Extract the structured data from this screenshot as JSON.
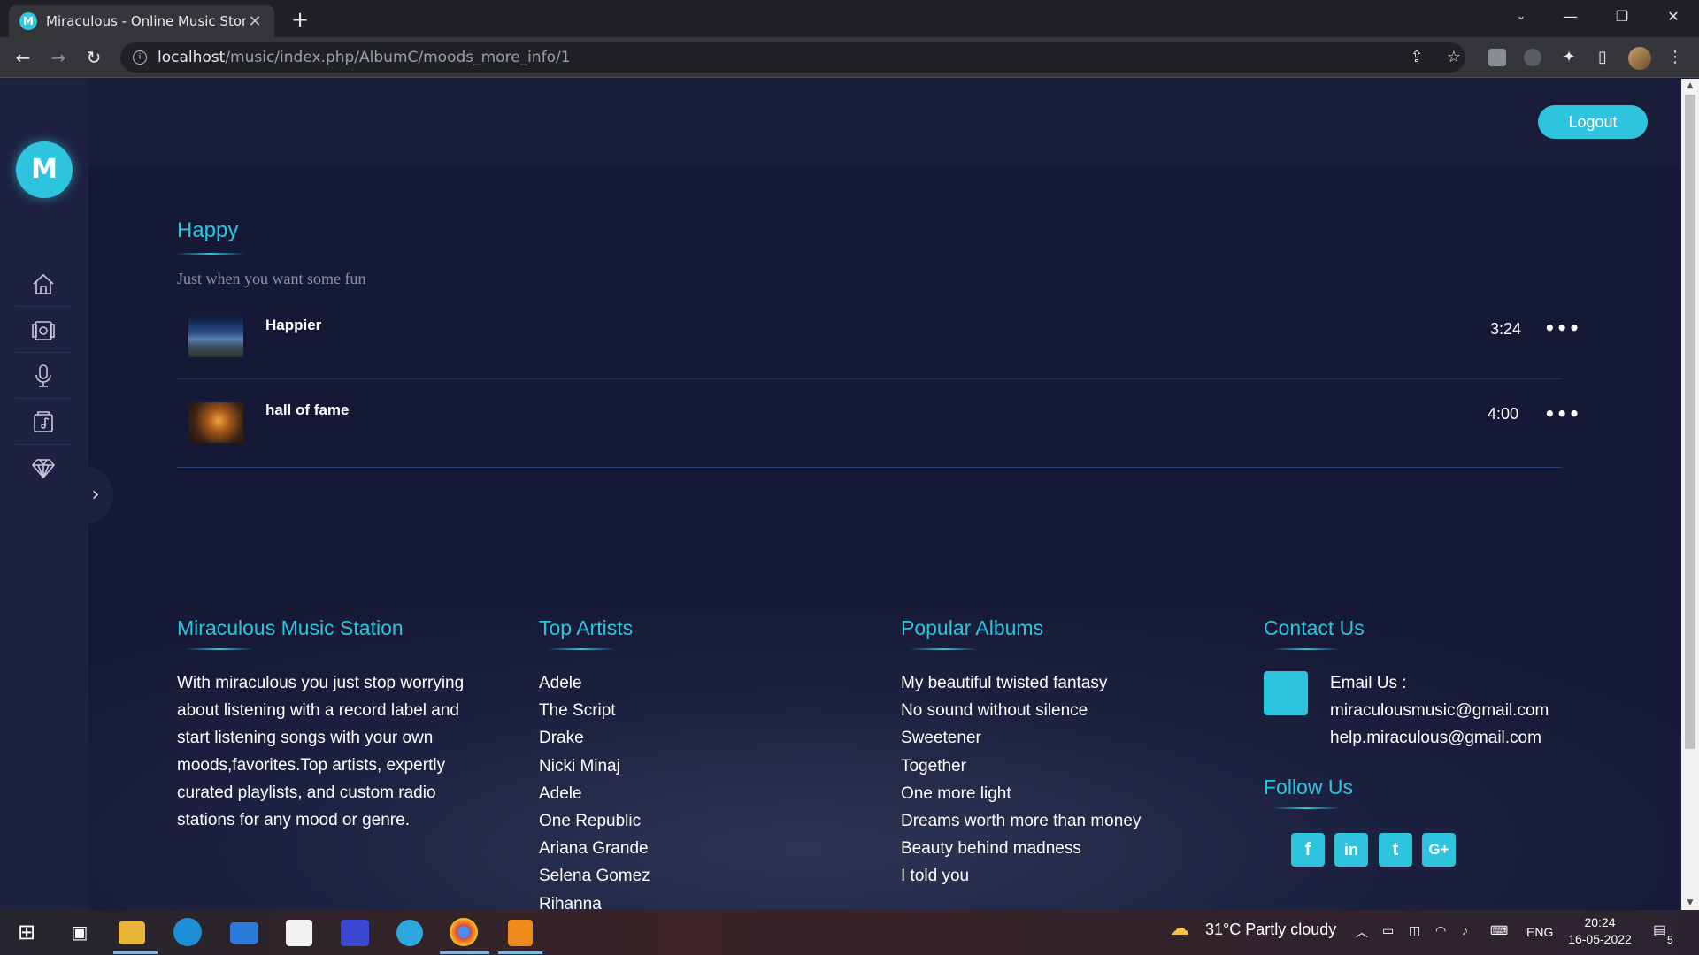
{
  "browser": {
    "tab_title": "Miraculous - Online Music Store",
    "favicon_letter": "M",
    "url_host": "localhost",
    "url_path": "/music/index.php/AlbumC/moods_more_info/1"
  },
  "app": {
    "logo_letter": "M",
    "logout_label": "Logout",
    "sidebar_icons": [
      "home-icon",
      "albums-icon",
      "microphone-icon",
      "music-file-icon",
      "diamond-icon"
    ]
  },
  "mood": {
    "title": "Happy",
    "subtitle": "Just when you want some fun",
    "songs": [
      {
        "name": "Happier",
        "duration": "3:24",
        "more": "•••"
      },
      {
        "name": "hall of fame",
        "duration": "4:00",
        "more": "•••"
      }
    ]
  },
  "footer": {
    "about_heading": "Miraculous Music Station",
    "about_text": "With miraculous you just stop worrying about listening with a record label and start listening songs with your own moods,favorites.Top artists, expertly curated playlists, and custom radio stations for any mood or genre.",
    "artists_heading": "Top Artists",
    "artists": [
      "Adele",
      "The Script",
      "Drake",
      "Nicki Minaj",
      "Adele",
      "One Republic",
      "Ariana Grande",
      "Selena Gomez",
      "Rihanna"
    ],
    "albums_heading": "Popular Albums",
    "albums": [
      "My beautiful twisted fantasy",
      "No sound without silence",
      "Sweetener",
      "Together",
      "One more light",
      "Dreams worth more than money",
      "Beauty behind madness",
      "I told you"
    ],
    "contact_heading": "Contact Us",
    "email_label": "Email Us :",
    "emails": [
      "miraculousmusic@gmail.com",
      "help.miraculous@gmail.com"
    ],
    "follow_heading": "Follow Us",
    "social": [
      "f",
      "in",
      "t",
      "G+"
    ]
  },
  "taskbar": {
    "weather": "31°C  Partly cloudy",
    "lang": "ENG",
    "time": "20:24",
    "date": "16-05-2022",
    "notifications": "5"
  },
  "colors": {
    "accent": "#2ec4dd",
    "page_bg": "#161935",
    "sidebar_bg": "#1e2140"
  }
}
